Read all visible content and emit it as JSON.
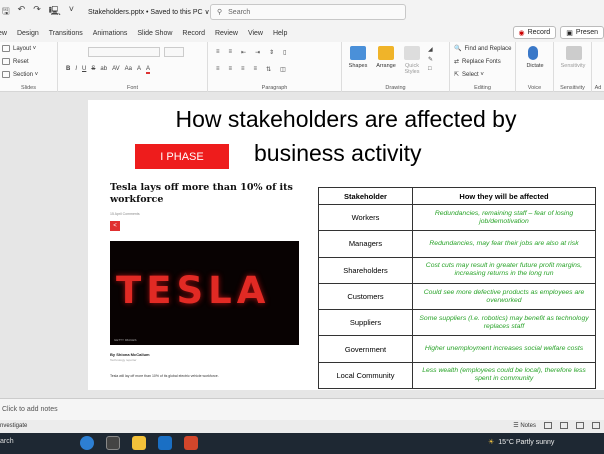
{
  "window": {
    "file_title": "Stakeholders.pptx • Saved to this PC ∨",
    "search_placeholder": "Search"
  },
  "tabs": [
    "ew",
    "Design",
    "Transitions",
    "Animations",
    "Slide Show",
    "Record",
    "Review",
    "View",
    "Help"
  ],
  "tab_buttons": {
    "record": "Record",
    "present": "Presen"
  },
  "ribbon": {
    "slides": {
      "layout": "Layout ˅",
      "reset": "Reset",
      "section": "Section ˅",
      "label": "Slides"
    },
    "font": {
      "format_row": [
        "B",
        "I",
        "U",
        "S",
        "ab",
        "AV",
        "Aa",
        "A",
        "A"
      ],
      "label": "Font"
    },
    "paragraph": {
      "label": "Paragraph"
    },
    "drawing": {
      "shapes": "Shapes",
      "arrange": "Arrange",
      "quick_styles": "Quick Styles",
      "label": "Drawing"
    },
    "editing": {
      "find": "Find and Replace",
      "replace_fonts": "Replace Fonts",
      "select": "Select ˅",
      "label": "Editing"
    },
    "voice": {
      "dictate": "Dictate",
      "label": "Voice"
    },
    "sensitivity": {
      "button": "Sensitivity",
      "label": "Sensitivity"
    },
    "add": {
      "label": "Ad"
    }
  },
  "slide": {
    "title_line1": "How stakeholders are affected by",
    "title_line2": "business activity",
    "phase_label": "I PHASE",
    "article": {
      "headline": "Tesla lays off more than 10% of its workforce",
      "meta": "15 April    Comments",
      "share": "<",
      "image_word": "TESLA",
      "image_credit": "GETTY IMAGES",
      "byline": "By Shiona McCallum",
      "byline_role": "Technology reporter",
      "caption": "Tesla will lay off more than 10% of its global electric vehicle workforce."
    },
    "table": {
      "headers": [
        "Stakeholder",
        "How they will be affected"
      ],
      "rows": [
        [
          "Workers",
          "Redundancies, remaining staff – fear of losing job/demotivation"
        ],
        [
          "Managers",
          "Redundancies, may fear their jobs are also at risk"
        ],
        [
          "Shareholders",
          "Cost cuts may result in greater future profit margins, increasing returns in the long run"
        ],
        [
          "Customers",
          "Could see more defective products as employees are overworked"
        ],
        [
          "Suppliers",
          "Some suppliers (I.e. robotics) may benefit as technology replaces staff"
        ],
        [
          "Government",
          "Higher unemployment increases social welfare costs"
        ],
        [
          "Local Community",
          "Less wealth (employees could be local), therefore less spent in community"
        ]
      ]
    }
  },
  "notes_placeholder": "Click to add notes",
  "status": {
    "left": "nvestigate",
    "notes": "Notes"
  },
  "taskbar": {
    "search": "arch",
    "weather": "15°C  Partly sunny"
  },
  "colors": {
    "phase_red": "#ee1c1c",
    "answer_green": "#27a227",
    "tesla_red": "#e12a24"
  }
}
